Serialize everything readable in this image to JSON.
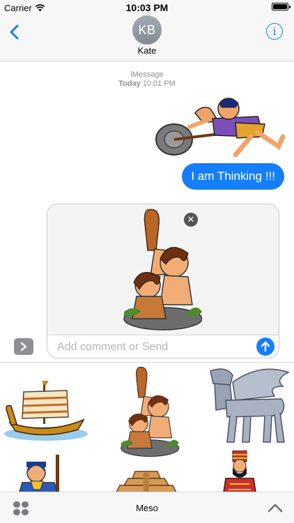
{
  "status_bar": {
    "carrier": "Carrier",
    "time": "10:03 PM"
  },
  "header": {
    "avatar_initials": "KB",
    "contact_name": "Kate"
  },
  "conversation": {
    "service": "iMessage",
    "date_label": "Today",
    "time_label": "10:01 PM",
    "outgoing_message": "I am Thinking !!!"
  },
  "compose": {
    "placeholder": "Add comment or Send",
    "remove_glyph": "✕"
  },
  "drawer": {
    "stickers": [
      "boat-sticker",
      "cavemen-sticker",
      "lamassu-sticker",
      "warrior-sticker",
      "ziggurat-sticker",
      "king-sticker"
    ]
  },
  "toolbar": {
    "app_name": "Meso"
  },
  "colors": {
    "accent": "#157efb",
    "bar_bg": "#f7f7f7"
  }
}
